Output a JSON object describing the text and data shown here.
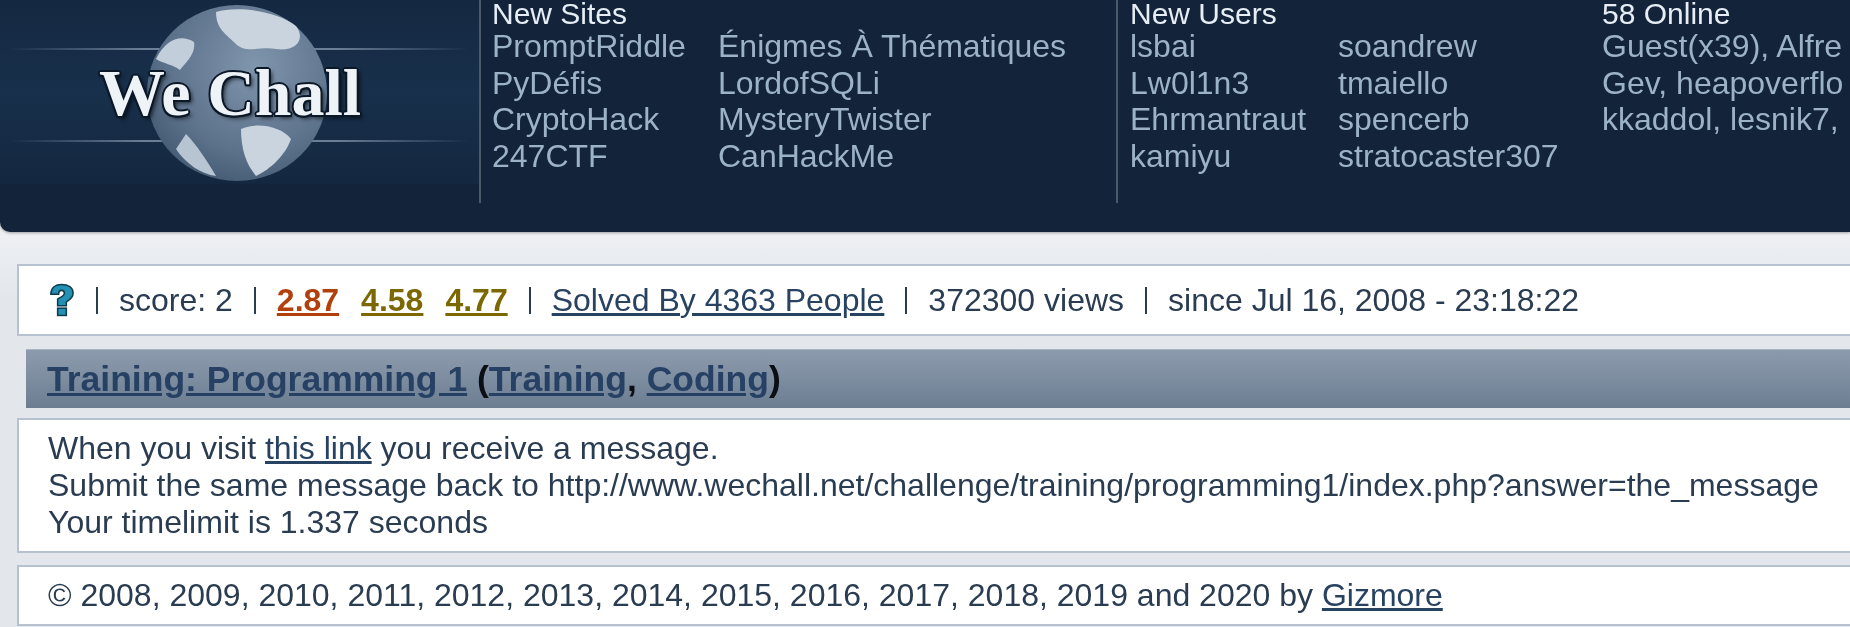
{
  "logo": {
    "text": "We Chall"
  },
  "new_sites": {
    "heading": "New Sites",
    "columns": [
      [
        "PromptRiddle",
        "PyDéfis",
        "CryptoHack",
        "247CTF"
      ],
      [
        "Énigmes À Thématiques",
        "LordofSQLi",
        "MysteryTwister",
        "CanHackMe"
      ]
    ]
  },
  "new_users": {
    "heading": "New Users",
    "columns": [
      [
        "lsbai",
        "Lw0l1n3",
        "Ehrmantraut",
        "kamiyu"
      ],
      [
        "soandrew",
        "tmaiello",
        "spencerb",
        "stratocaster307"
      ]
    ]
  },
  "online": {
    "heading": "58 Online",
    "lines": [
      "Guest(x39), Alfre",
      "Gev, heapoverflo",
      "kkaddol, lesnik7,"
    ]
  },
  "stats": {
    "score": "score: 2",
    "ratings": [
      {
        "text": "2.87",
        "color": "#b2400c"
      },
      {
        "text": "4.58",
        "color": "#7b6800"
      },
      {
        "text": "4.77",
        "color": "#7b6800"
      }
    ],
    "solved_by": "Solved By 4363 People",
    "views": "372300 views",
    "since": "since Jul 16, 2008 - 23:18:22"
  },
  "title": {
    "parts": [
      {
        "kind": "link",
        "text": "Training: Programming 1"
      },
      {
        "kind": "text",
        "text": " ("
      },
      {
        "kind": "link",
        "text": "Training"
      },
      {
        "kind": "text",
        "text": ", "
      },
      {
        "kind": "link",
        "text": "Coding"
      },
      {
        "kind": "text",
        "text": ")"
      }
    ]
  },
  "description": {
    "lines": [
      {
        "parts": [
          {
            "kind": "text",
            "text": "When you visit "
          },
          {
            "kind": "link",
            "text": "this link"
          },
          {
            "kind": "text",
            "text": " you receive a message."
          }
        ]
      },
      {
        "parts": [
          {
            "kind": "text",
            "text": "Submit the same message back to http://www.wechall.net/challenge/training/programming1/index.php?answer=the_message"
          }
        ]
      },
      {
        "parts": [
          {
            "kind": "text",
            "text": "Your timelimit is 1.337 seconds"
          }
        ]
      }
    ]
  },
  "footer": {
    "parts": [
      {
        "kind": "text",
        "text": "© 2008, 2009, 2010, 2011, 2012, 2013, 2014, 2015, 2016, 2017, 2018, 2019 and 2020 by "
      },
      {
        "kind": "link",
        "text": "Gizmore"
      }
    ]
  }
}
